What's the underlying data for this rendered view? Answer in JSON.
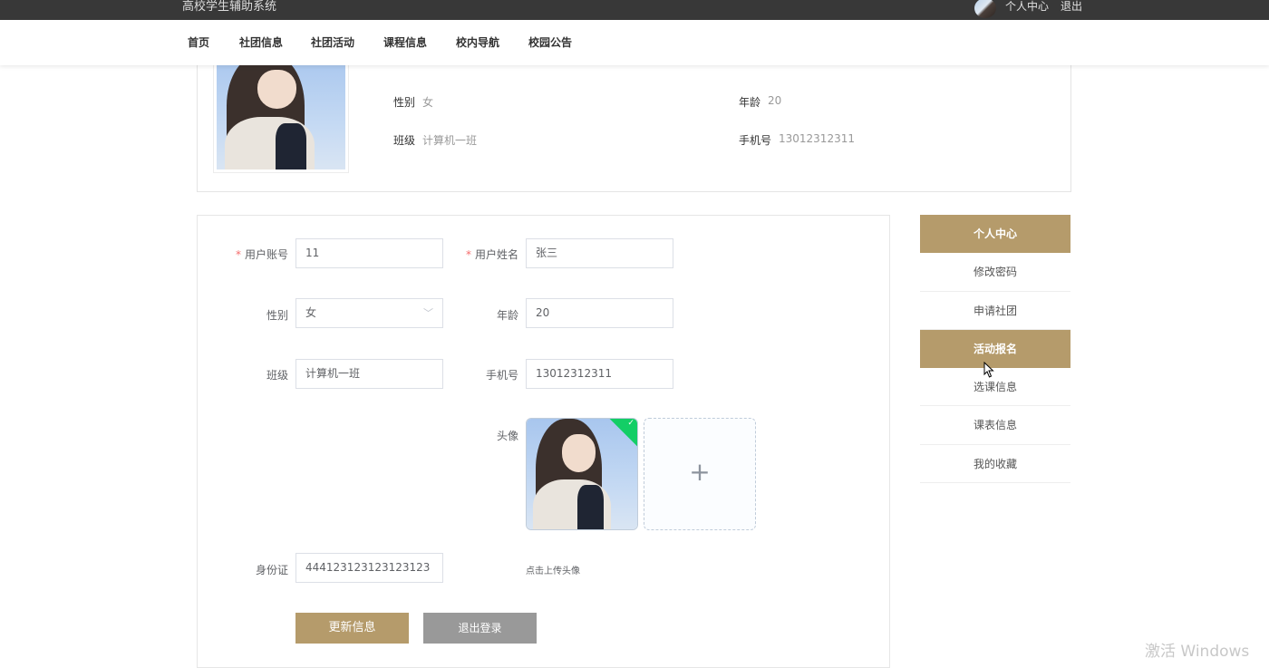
{
  "topbar": {
    "site_title": "高校学生辅助系统",
    "user_center": "个人中心",
    "logout": "退出"
  },
  "nav": {
    "items": [
      "首页",
      "社团信息",
      "社团活动",
      "课程信息",
      "校内导航",
      "校园公告"
    ]
  },
  "profile": {
    "gender_label": "性别",
    "gender_value": "女",
    "age_label": "年龄",
    "age_value": "20",
    "class_label": "班级",
    "class_value": "计算机一班",
    "phone_label": "手机号",
    "phone_value": "13012312311"
  },
  "form": {
    "account_label": "用户账号",
    "account_value": "11",
    "name_label": "用户姓名",
    "name_value": "张三",
    "gender_label": "性别",
    "gender_value": "女",
    "age_label": "年龄",
    "age_value": "20",
    "class_label": "班级",
    "class_value": "计算机一班",
    "phone_label": "手机号",
    "phone_value": "13012312311",
    "avatar_label": "头像",
    "id_label": "身份证",
    "id_value": "444123123123123123",
    "upload_tip": "点击上传头像",
    "update_button": "更新信息",
    "logout_button": "退出登录"
  },
  "side_menu": {
    "items": [
      {
        "label": "个人中心",
        "active": true
      },
      {
        "label": "修改密码",
        "active": false
      },
      {
        "label": "申请社团",
        "active": false
      },
      {
        "label": "活动报名",
        "active": true
      },
      {
        "label": "选课信息",
        "active": false
      },
      {
        "label": "课表信息",
        "active": false
      },
      {
        "label": "我的收藏",
        "active": false
      }
    ]
  },
  "watermark": "激活 Windows",
  "colors": {
    "accent": "#b59b6b",
    "topbar": "#383838",
    "success": "#13ce66"
  }
}
